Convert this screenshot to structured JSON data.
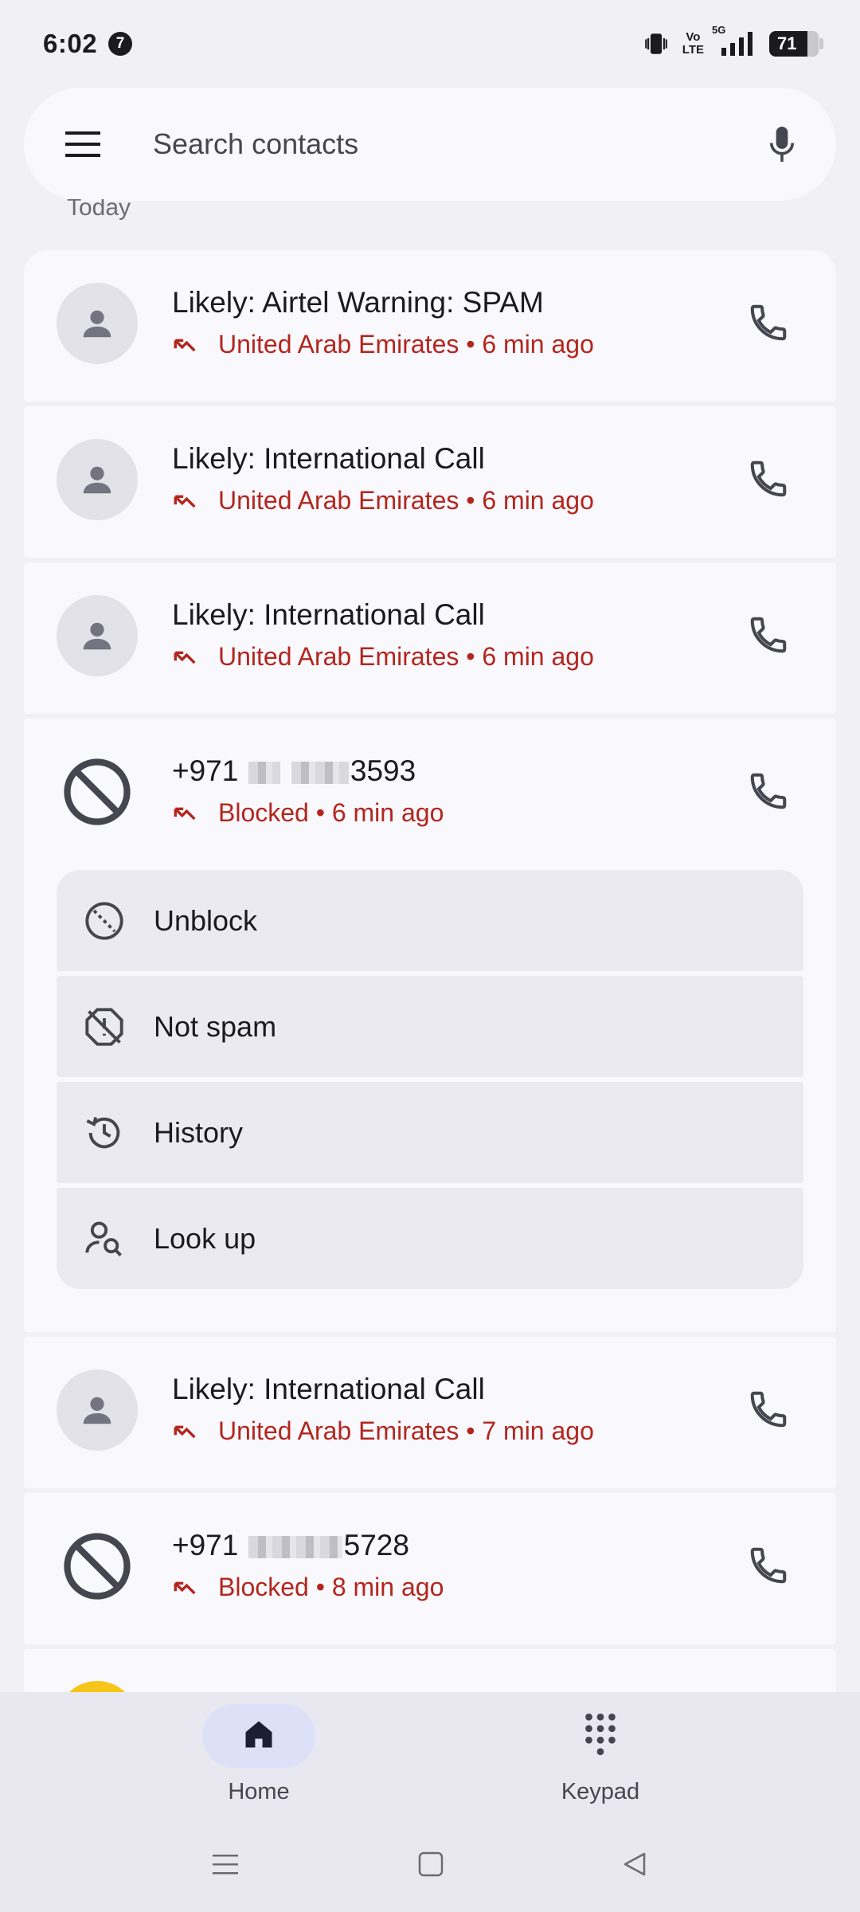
{
  "status_bar": {
    "time": "6:02",
    "notification_count": "7",
    "network_label": "5G",
    "volte_line1": "Vo",
    "volte_line2": "LTE",
    "battery": "71"
  },
  "search": {
    "placeholder": "Search contacts"
  },
  "section_label": "Today",
  "calls": [
    {
      "name": "Likely: Airtel Warning: SPAM",
      "subtitle": "United Arab Emirates • 6 min ago",
      "avatar": "person-icon"
    },
    {
      "name": "Likely: International Call",
      "subtitle": "United Arab Emirates • 6 min ago",
      "avatar": "person-icon"
    },
    {
      "name": "Likely: International Call",
      "subtitle": "United Arab Emirates • 6 min ago",
      "avatar": "person-icon"
    }
  ],
  "expanded_call": {
    "name_prefix": "+971",
    "name_suffix": "3593",
    "subtitle": "Blocked • 6 min ago",
    "avatar": "block-icon",
    "actions": [
      {
        "label": "Unblock",
        "icon": "unblock-icon"
      },
      {
        "label": "Not spam",
        "icon": "not-spam-icon"
      },
      {
        "label": "History",
        "icon": "history-icon"
      },
      {
        "label": "Look up",
        "icon": "lookup-icon"
      }
    ]
  },
  "calls_after": [
    {
      "name": "Likely: International Call",
      "subtitle": "United Arab Emirates • 7 min ago",
      "avatar": "person-icon"
    },
    {
      "name_prefix": "+971",
      "name_suffix": "5728",
      "subtitle": "Blocked • 8 min ago",
      "avatar": "block-icon"
    }
  ],
  "bottom_nav": {
    "home": "Home",
    "keypad": "Keypad"
  },
  "colors": {
    "missed_red": "#b3261e",
    "background": "#f1f0f5",
    "card": "#f9f8fd",
    "nav_active": "#dde1f7"
  }
}
